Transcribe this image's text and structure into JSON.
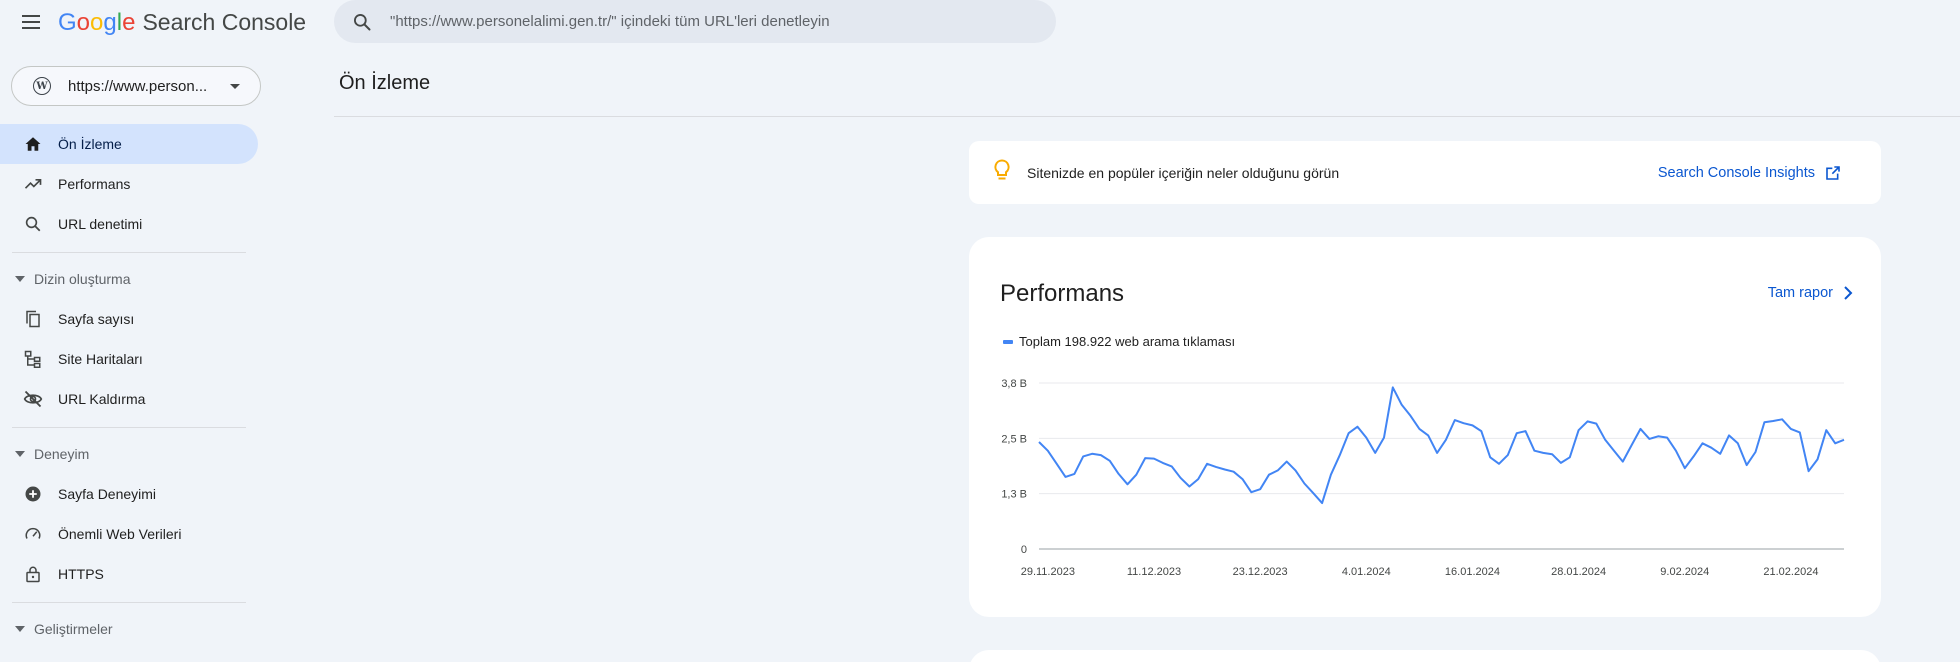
{
  "header": {
    "brand_letters": [
      "G",
      "o",
      "o",
      "g",
      "l",
      "e"
    ],
    "product": "Search Console",
    "search_placeholder": "\"https://www.personelalimi.gen.tr/\" içindeki tüm URL'leri denetleyin"
  },
  "property": {
    "label": "https://www.person..."
  },
  "sidebar": {
    "items_top": [
      {
        "label": "Ön İzleme",
        "icon": "home-icon",
        "active": true
      },
      {
        "label": "Performans",
        "icon": "trending-up-icon"
      },
      {
        "label": "URL denetimi",
        "icon": "search-icon"
      }
    ],
    "sections": [
      {
        "label": "Dizin oluşturma",
        "items": [
          {
            "label": "Sayfa sayısı",
            "icon": "pages-icon"
          },
          {
            "label": "Site Haritaları",
            "icon": "sitemap-icon"
          },
          {
            "label": "URL Kaldırma",
            "icon": "visibility-off-icon"
          }
        ]
      },
      {
        "label": "Deneyim",
        "items": [
          {
            "label": "Sayfa Deneyimi",
            "icon": "add-circle-icon"
          },
          {
            "label": "Önemli Web Verileri",
            "icon": "speed-icon"
          },
          {
            "label": "HTTPS",
            "icon": "lock-icon"
          }
        ]
      },
      {
        "label": "Geliştirmeler",
        "items": []
      }
    ]
  },
  "main": {
    "page_title": "Ön İzleme",
    "insights": {
      "text": "Sitenizde en popüler içeriğin neler olduğunu görün",
      "link": "Search Console Insights"
    },
    "performance": {
      "title": "Performans",
      "full_report": "Tam rapor"
    }
  },
  "colors": {
    "accent": "#0b57d0",
    "series": "#4285f4",
    "active_nav": "#d3e3fd",
    "background": "#f0f4f9",
    "bulb": "#f9ab00"
  },
  "chart_data": {
    "type": "line",
    "series": [
      {
        "name": "Toplam 198.922 web arama tıklaması",
        "values": [
          2.45,
          2.25,
          1.95,
          1.65,
          1.72,
          2.12,
          2.18,
          2.15,
          2.02,
          1.72,
          1.48,
          1.7,
          2.08,
          2.07,
          1.97,
          1.89,
          1.63,
          1.43,
          1.6,
          1.95,
          1.88,
          1.82,
          1.77,
          1.6,
          1.3,
          1.37,
          1.7,
          1.8,
          2.0,
          1.8,
          1.5,
          1.28,
          1.05,
          1.7,
          2.15,
          2.65,
          2.8,
          2.55,
          2.2,
          2.55,
          3.7,
          3.3,
          3.05,
          2.75,
          2.6,
          2.2,
          2.5,
          2.95,
          2.88,
          2.83,
          2.7,
          2.1,
          1.95,
          2.15,
          2.65,
          2.7,
          2.25,
          2.2,
          2.17,
          1.97,
          2.1,
          2.72,
          2.92,
          2.87,
          2.5,
          2.25,
          2.0,
          2.38,
          2.75,
          2.52,
          2.58,
          2.55,
          2.25,
          1.85,
          2.12,
          2.42,
          2.32,
          2.18,
          2.6,
          2.42,
          1.92,
          2.22,
          2.9,
          2.93,
          2.97,
          2.75,
          2.67,
          1.78,
          2.05,
          2.72,
          2.42,
          2.5
        ]
      }
    ],
    "x_tick_labels": [
      "29.11.2023",
      "11.12.2023",
      "23.12.2023",
      "4.01.2024",
      "16.01.2024",
      "28.01.2024",
      "9.02.2024",
      "21.02.2024"
    ],
    "y_tick_labels": [
      "0",
      "1,3 B",
      "2,5 B",
      "3,8 B"
    ],
    "x_range": [
      "2023-11-28",
      "2024-02-27"
    ],
    "ylim": [
      0,
      3.8
    ],
    "grid": true
  }
}
